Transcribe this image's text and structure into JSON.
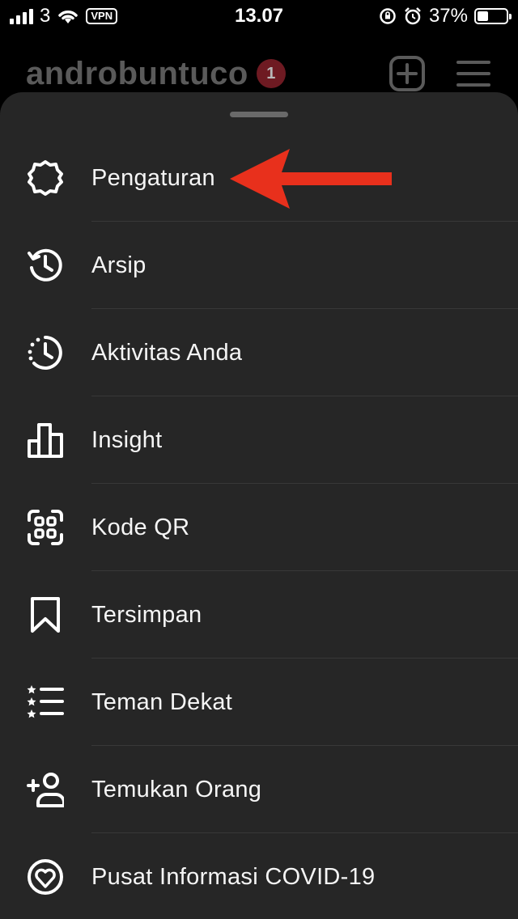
{
  "status_bar": {
    "carrier": "3",
    "vpn": "VPN",
    "time": "13.07",
    "battery_percent": "37%",
    "battery_level": 0.37
  },
  "header": {
    "username": "androbuntuco",
    "notification_count": "1"
  },
  "menu": {
    "items": [
      {
        "label": "Pengaturan",
        "icon": "gear-icon"
      },
      {
        "label": "Arsip",
        "icon": "archive-history-icon"
      },
      {
        "label": "Aktivitas Anda",
        "icon": "activity-clock-icon"
      },
      {
        "label": "Insight",
        "icon": "bar-chart-icon"
      },
      {
        "label": "Kode QR",
        "icon": "qr-code-icon"
      },
      {
        "label": "Tersimpan",
        "icon": "bookmark-icon"
      },
      {
        "label": "Teman Dekat",
        "icon": "star-list-icon"
      },
      {
        "label": "Temukan Orang",
        "icon": "add-person-icon"
      },
      {
        "label": "Pusat Informasi COVID-19",
        "icon": "heart-circle-icon"
      }
    ]
  },
  "colors": {
    "sheet_background": "#262626",
    "annotation_arrow": "#e8301c"
  }
}
